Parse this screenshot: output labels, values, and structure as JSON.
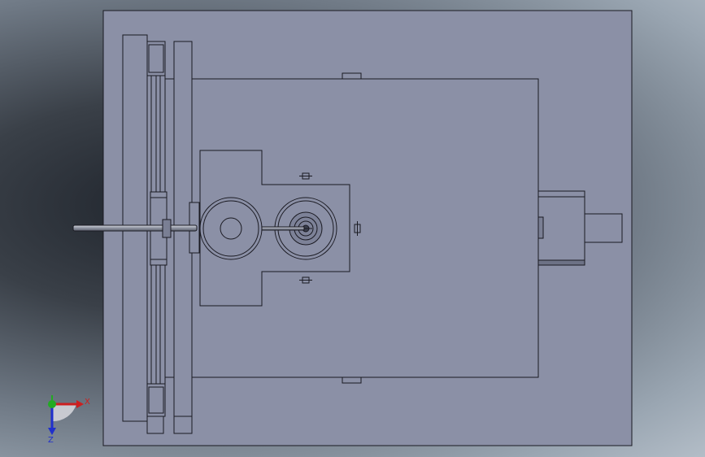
{
  "view": {
    "model_fill": "#8b90a6",
    "edge_color": "#1a1a22",
    "shaft_color": "#a9aebb"
  },
  "triad": {
    "x_label": "X",
    "z_label": "Z",
    "x_color": "#cc1f1f",
    "y_color": "#22aa22",
    "z_color": "#1f2fcc"
  }
}
